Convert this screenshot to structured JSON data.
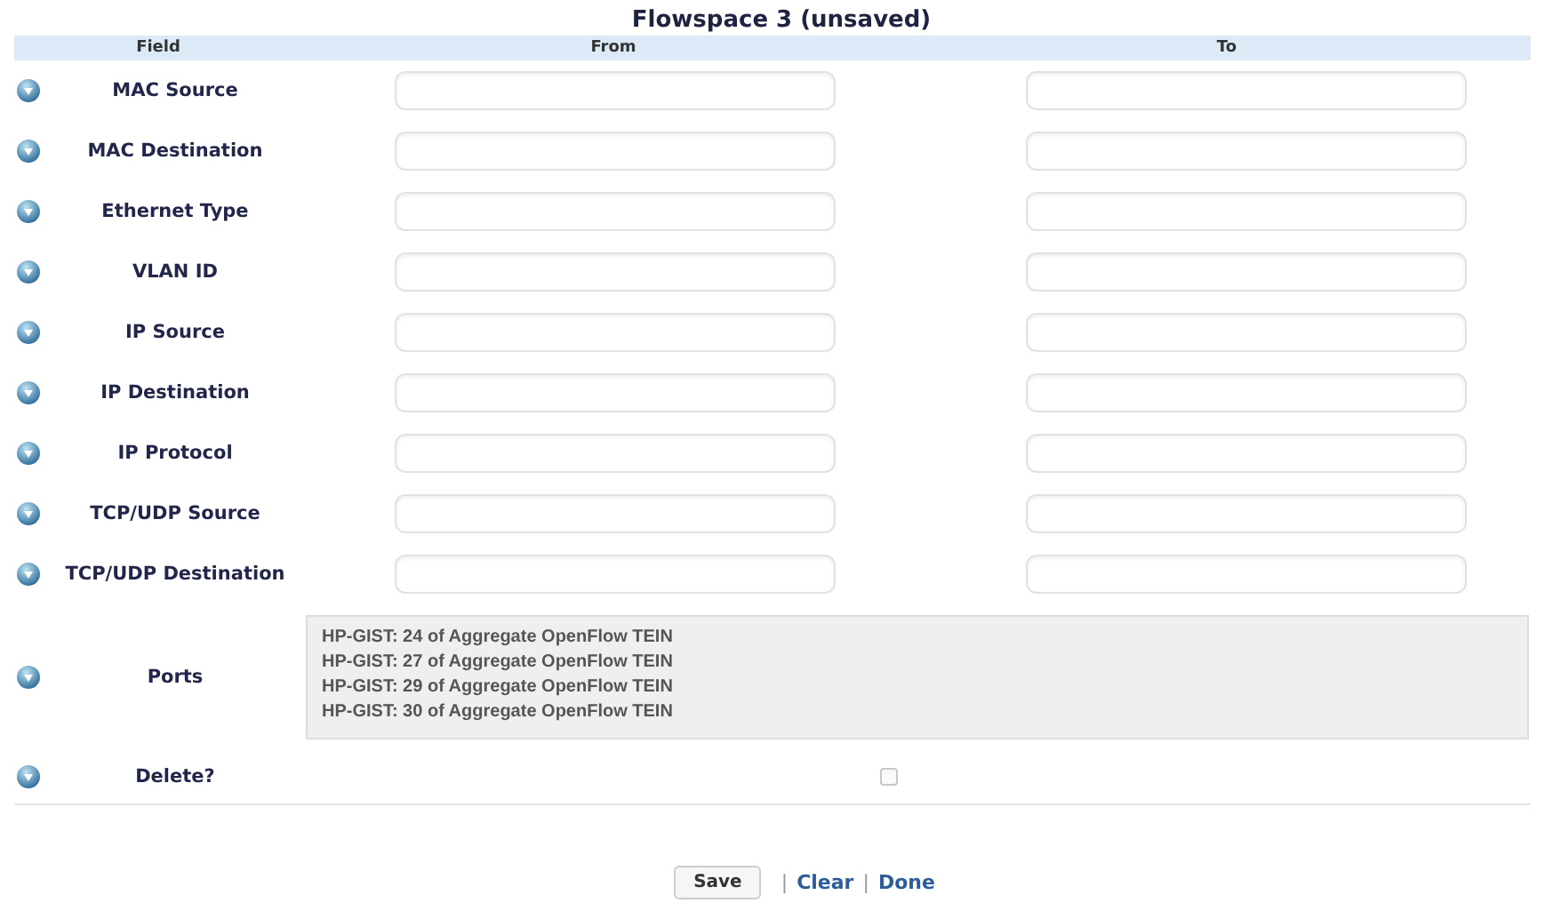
{
  "title": "Flowspace 3 (unsaved)",
  "columns": [
    "Field",
    "From",
    "To"
  ],
  "rows": [
    {
      "kind": "range",
      "label": "MAC Source"
    },
    {
      "kind": "range",
      "label": "MAC Destination"
    },
    {
      "kind": "range",
      "label": "Ethernet Type"
    },
    {
      "kind": "range",
      "label": "VLAN ID"
    },
    {
      "kind": "range",
      "label": "IP Source"
    },
    {
      "kind": "range",
      "label": "IP Destination"
    },
    {
      "kind": "range",
      "label": "IP Protocol"
    },
    {
      "kind": "range",
      "label": "TCP/UDP Source"
    },
    {
      "kind": "range",
      "label": "TCP/UDP Destination"
    },
    {
      "kind": "list",
      "label": "Ports",
      "options": [
        {
          "text": "HP-GIST: 24 of Aggregate OpenFlow TEIN",
          "selected": false
        },
        {
          "text": "HP-GIST: 27 of Aggregate OpenFlow TEIN",
          "selected": false
        },
        {
          "text": "HP-GIST: 29 of Aggregate OpenFlow TEIN",
          "selected": false
        },
        {
          "text": "HP-GIST: 30 of Aggregate OpenFlow TEIN",
          "selected": false
        }
      ]
    },
    {
      "kind": "checkbox",
      "label": "Delete?",
      "checked": false
    }
  ],
  "actions": [
    {
      "kind": "button",
      "label": "Save"
    },
    {
      "kind": "separator",
      "label": "|"
    },
    {
      "kind": "link",
      "label": "Clear"
    },
    {
      "kind": "separator",
      "label": "|"
    },
    {
      "kind": "link",
      "label": "Done"
    }
  ]
}
